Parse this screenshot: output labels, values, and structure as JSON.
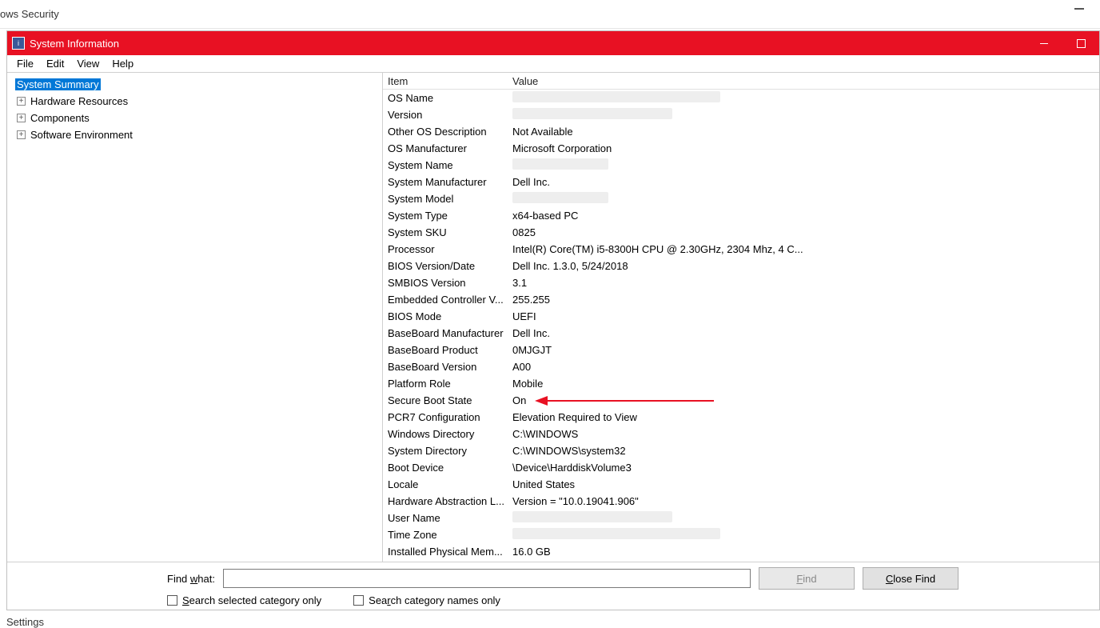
{
  "background": {
    "title_partial": "ows Security",
    "bottom_partial": "Settings"
  },
  "window": {
    "title": "System Information",
    "controls": {
      "min": "–",
      "max": "☐"
    }
  },
  "menu": {
    "items": [
      "File",
      "Edit",
      "View",
      "Help"
    ]
  },
  "tree": {
    "selected": "System Summary",
    "children": [
      "Hardware Resources",
      "Components",
      "Software Environment"
    ]
  },
  "details": {
    "header_item": "Item",
    "header_value": "Value",
    "rows": [
      {
        "item": "OS Name",
        "value": "",
        "redact": "long"
      },
      {
        "item": "Version",
        "value": "",
        "redact": "med"
      },
      {
        "item": "Other OS Description",
        "value": "Not Available"
      },
      {
        "item": "OS Manufacturer",
        "value": "Microsoft Corporation"
      },
      {
        "item": "System Name",
        "value": "",
        "redact": "short"
      },
      {
        "item": "System Manufacturer",
        "value": "Dell Inc."
      },
      {
        "item": "System Model",
        "value": "",
        "redact": "short"
      },
      {
        "item": "System Type",
        "value": "x64-based PC"
      },
      {
        "item": "System SKU",
        "value": "0825"
      },
      {
        "item": "Processor",
        "value": "Intel(R) Core(TM) i5-8300H CPU @ 2.30GHz, 2304 Mhz, 4 C..."
      },
      {
        "item": "BIOS Version/Date",
        "value": "Dell Inc. 1.3.0, 5/24/2018"
      },
      {
        "item": "SMBIOS Version",
        "value": "3.1"
      },
      {
        "item": "Embedded Controller V...",
        "value": "255.255"
      },
      {
        "item": "BIOS Mode",
        "value": "UEFI"
      },
      {
        "item": "BaseBoard Manufacturer",
        "value": "Dell Inc."
      },
      {
        "item": "BaseBoard Product",
        "value": "0MJGJT"
      },
      {
        "item": "BaseBoard Version",
        "value": "A00"
      },
      {
        "item": "Platform Role",
        "value": "Mobile"
      },
      {
        "item": "Secure Boot State",
        "value": "On",
        "highlight": true
      },
      {
        "item": "PCR7 Configuration",
        "value": "Elevation Required to View"
      },
      {
        "item": "Windows Directory",
        "value": "C:\\WINDOWS"
      },
      {
        "item": "System Directory",
        "value": "C:\\WINDOWS\\system32"
      },
      {
        "item": "Boot Device",
        "value": "\\Device\\HarddiskVolume3"
      },
      {
        "item": "Locale",
        "value": "United States"
      },
      {
        "item": "Hardware Abstraction L...",
        "value": "Version = \"10.0.19041.906\""
      },
      {
        "item": "User Name",
        "value": "",
        "redact": "med"
      },
      {
        "item": "Time Zone",
        "value": "",
        "redact": "long"
      },
      {
        "item": "Installed Physical Mem...",
        "value": "16.0 GB"
      }
    ]
  },
  "find": {
    "label_prefix": "Find ",
    "label_uline": "w",
    "label_suffix": "hat:",
    "placeholder": "",
    "find_btn": "Find",
    "close_btn": "Close Find",
    "chk1_prefix": "",
    "chk1_uline": "S",
    "chk1_suffix": "earch selected category only",
    "chk2_prefix": "Sea",
    "chk2_uline": "r",
    "chk2_suffix": "ch category names only"
  }
}
